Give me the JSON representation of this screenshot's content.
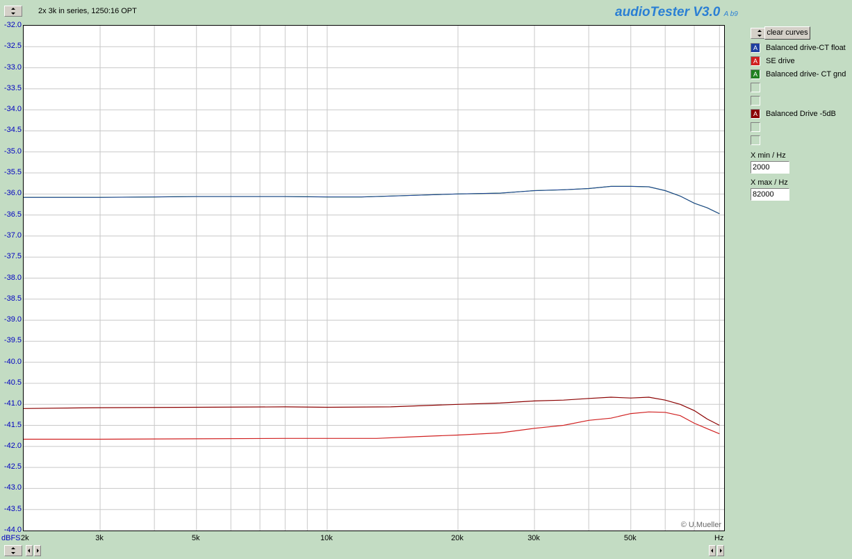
{
  "header": {
    "subtitle": "2x 3k in series, 1250:16 OPT",
    "brand": "audioTester V3.0",
    "brand_small": "A b9",
    "brand_color": "#2a7fd4"
  },
  "controls": {
    "clear_curves": "clear curves",
    "xmin_label": "X min / Hz",
    "xmin_value": "2000",
    "xmax_label": "X max / Hz",
    "xmax_value": "82000"
  },
  "legend": [
    {
      "name": "Balanced drive-CT float",
      "color": "#1f3fa0",
      "glyph": "A"
    },
    {
      "name": "SE drive",
      "color": "#d02020",
      "glyph": "A"
    },
    {
      "name": "Balanced drive- CT gnd",
      "color": "#208020",
      "glyph": "A"
    },
    {
      "name": "",
      "color": "",
      "glyph": ""
    },
    {
      "name": "",
      "color": "",
      "glyph": ""
    },
    {
      "name": "Balanced Drive -5dB",
      "color": "#8b0000",
      "glyph": "A"
    },
    {
      "name": "",
      "color": "",
      "glyph": ""
    },
    {
      "name": "",
      "color": "",
      "glyph": ""
    }
  ],
  "copyright": "© U.Mueller",
  "chart_data": {
    "type": "line",
    "xscale": "log",
    "xlim": [
      2000,
      82000
    ],
    "ylim": [
      -44.0,
      -32.0
    ],
    "ylabel": "dBFS",
    "xunit": "Hz",
    "grid": true,
    "yticks": [
      "-32.0",
      "-32.5",
      "-33.0",
      "-33.5",
      "-34.0",
      "-34.5",
      "-35.0",
      "-35.5",
      "-36.0",
      "-36.5",
      "-37.0",
      "-37.5",
      "-38.0",
      "-38.5",
      "-39.0",
      "-39.5",
      "-40.0",
      "-40.5",
      "-41.0",
      "-41.5",
      "-42.0",
      "-42.5",
      "-43.0",
      "-43.5",
      "-44.0"
    ],
    "xtick_labels": [
      {
        "value": 2000,
        "label": "2k"
      },
      {
        "value": 3000,
        "label": "3k"
      },
      {
        "value": 5000,
        "label": "5k"
      },
      {
        "value": 10000,
        "label": "10k"
      },
      {
        "value": 20000,
        "label": "20k"
      },
      {
        "value": 30000,
        "label": "30k"
      },
      {
        "value": 50000,
        "label": "50k"
      }
    ],
    "series": [
      {
        "name": "Balanced drive- CT gnd",
        "color": "#208020",
        "width": 1.2,
        "x": [
          2000,
          3000,
          4000,
          5000,
          8000,
          10000,
          12000,
          16000,
          20000,
          25000,
          30000,
          35000,
          40000,
          45000,
          50000,
          55000,
          60000,
          65000,
          70000,
          75000,
          80000
        ],
        "y": [
          -36.08,
          -36.08,
          -36.07,
          -36.06,
          -36.06,
          -36.07,
          -36.07,
          -36.03,
          -36.0,
          -35.98,
          -35.92,
          -35.9,
          -35.87,
          -35.82,
          -35.82,
          -35.83,
          -35.92,
          -36.05,
          -36.22,
          -36.33,
          -36.47
        ]
      },
      {
        "name": "Balanced drive-CT float",
        "color": "#1f3fa0",
        "width": 1.0,
        "x": [
          2000,
          3000,
          4000,
          5000,
          8000,
          10000,
          12000,
          16000,
          20000,
          25000,
          30000,
          35000,
          40000,
          45000,
          50000,
          55000,
          60000,
          65000,
          70000,
          75000,
          80000
        ],
        "y": [
          -36.08,
          -36.08,
          -36.07,
          -36.06,
          -36.06,
          -36.07,
          -36.07,
          -36.03,
          -36.0,
          -35.98,
          -35.92,
          -35.9,
          -35.87,
          -35.82,
          -35.82,
          -35.83,
          -35.92,
          -36.05,
          -36.22,
          -36.33,
          -36.47
        ]
      },
      {
        "name": "Balanced Drive -5dB",
        "color": "#8b0000",
        "width": 1.2,
        "x": [
          2000,
          3000,
          5000,
          8000,
          10000,
          14000,
          20000,
          25000,
          30000,
          35000,
          40000,
          45000,
          50000,
          55000,
          60000,
          65000,
          70000,
          75000,
          80000
        ],
        "y": [
          -41.1,
          -41.08,
          -41.07,
          -41.06,
          -41.07,
          -41.06,
          -41.0,
          -40.97,
          -40.92,
          -40.9,
          -40.86,
          -40.83,
          -40.85,
          -40.83,
          -40.9,
          -41.0,
          -41.15,
          -41.35,
          -41.5
        ]
      },
      {
        "name": "SE drive",
        "color": "#d02020",
        "width": 1.2,
        "x": [
          2000,
          3000,
          5000,
          8000,
          10000,
          13000,
          16000,
          20000,
          25000,
          30000,
          35000,
          40000,
          45000,
          50000,
          55000,
          60000,
          65000,
          70000,
          75000,
          80000
        ],
        "y": [
          -41.83,
          -41.83,
          -41.82,
          -41.81,
          -41.81,
          -41.81,
          -41.77,
          -41.73,
          -41.68,
          -41.57,
          -41.5,
          -41.38,
          -41.33,
          -41.22,
          -41.18,
          -41.19,
          -41.27,
          -41.45,
          -41.58,
          -41.7
        ]
      }
    ]
  }
}
